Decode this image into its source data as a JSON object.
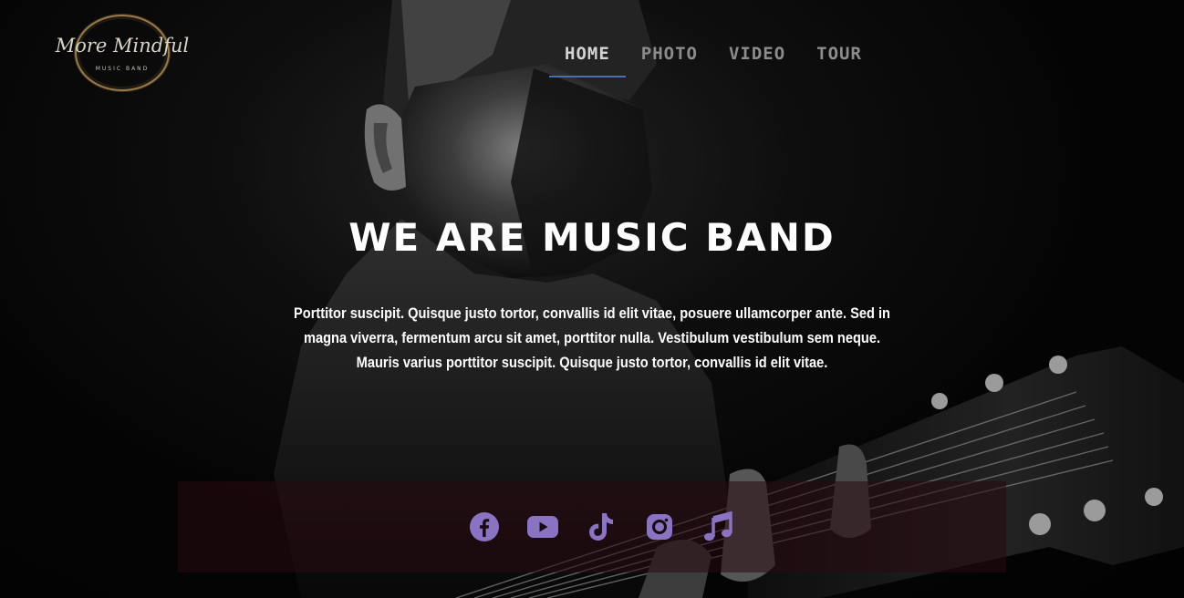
{
  "brand": {
    "logo_script": "More Mindful",
    "logo_subtitle": "MUSIC BAND"
  },
  "nav": {
    "items": [
      {
        "label": "HOME",
        "active": true
      },
      {
        "label": "PHOTO",
        "active": false
      },
      {
        "label": "VIDEO",
        "active": false
      },
      {
        "label": "TOUR",
        "active": false
      }
    ]
  },
  "hero": {
    "headline": "WE ARE MUSIC BAND",
    "lede": "Porttitor suscipit. Quisque justo tortor, convallis id elit vitae, posuere ullamcorper ante. Sed in magna viverra, fermentum arcu sit amet, porttitor nulla. Vestibulum vestibulum sem neque. Mauris varius porttitor suscipit. Quisque justo tortor, convallis id elit vitae."
  },
  "social": {
    "icons": [
      "facebook-icon",
      "youtube-icon",
      "tiktok-icon",
      "instagram-icon",
      "music-note-icon"
    ]
  },
  "colors": {
    "nav_active_underline": "#4a6db5",
    "social_icon": "#8a73c2",
    "social_bar_bg": "#280a10",
    "logo_gold": "#9a7a48"
  }
}
